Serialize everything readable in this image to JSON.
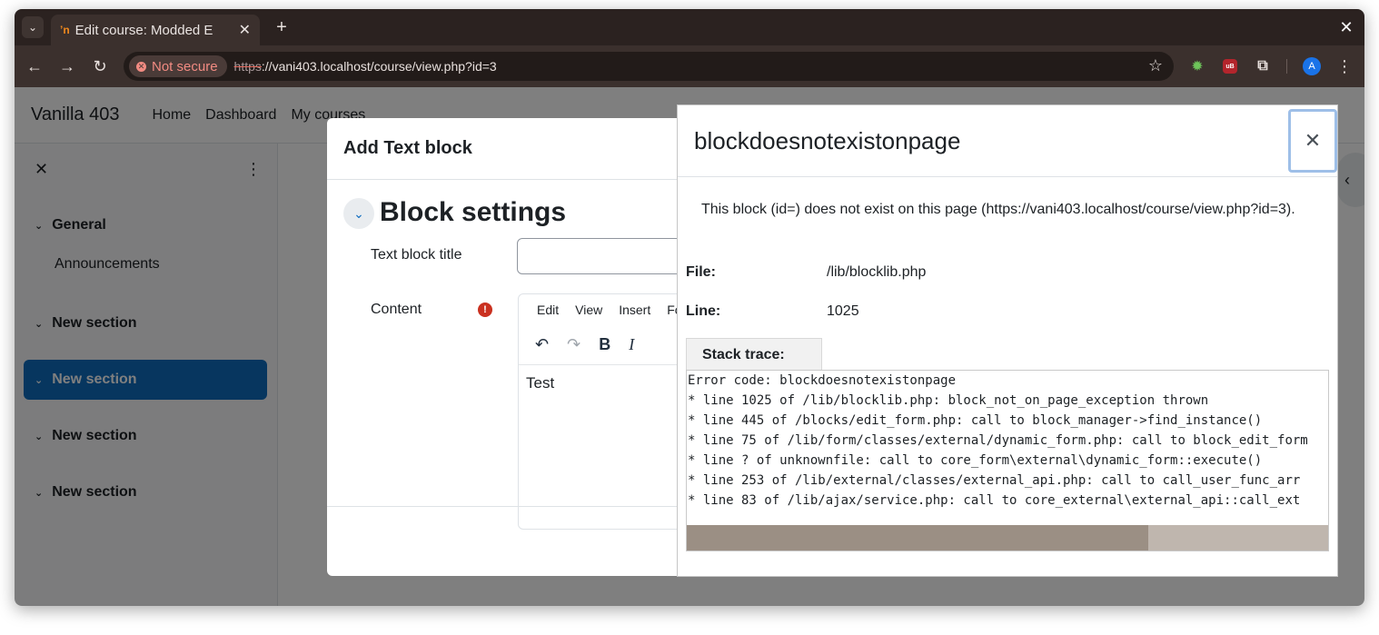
{
  "browser": {
    "tab_title": "Edit course: Modded E",
    "favicon": "ʼn",
    "security_label": "Not secure",
    "url_scheme": "https",
    "url_rest": "://vani403.localhost/course/view.php?id=3",
    "profile_initial": "A"
  },
  "navbar": {
    "site_name": "Vanilla 403",
    "links": [
      "Home",
      "Dashboard",
      "My courses"
    ]
  },
  "drawer": {
    "items": [
      {
        "label": "General"
      },
      {
        "label": "New section"
      },
      {
        "label": "New section"
      },
      {
        "label": "New section"
      },
      {
        "label": "New section"
      }
    ],
    "sub_item": "Announcements"
  },
  "add_block_modal": {
    "title": "Add Text block",
    "section_title": "Block settings",
    "title_label": "Text block title",
    "content_label": "Content",
    "editor_menu": [
      "Edit",
      "View",
      "Insert",
      "Fo"
    ],
    "editor_text": "Test"
  },
  "error_modal": {
    "title": "blockdoesnotexistonpage",
    "message": "This block (id=) does not exist on this page (https://vani403.localhost/course/view.php?id=3).",
    "file_label": "File:",
    "file_value": "/lib/blocklib.php",
    "line_label": "Line:",
    "line_value": "1025",
    "stack_label": "Stack trace:",
    "stack_trace": "Error code: blockdoesnotexistonpage\n* line 1025 of /lib/blocklib.php: block_not_on_page_exception thrown\n* line 445 of /blocks/edit_form.php: call to block_manager->find_instance()\n* line 75 of /lib/form/classes/external/dynamic_form.php: call to block_edit_form\n* line ? of unknownfile: call to core_form\\external\\dynamic_form::execute()\n* line 253 of /lib/external/classes/external_api.php: call to call_user_func_arr\n* line 83 of /lib/ajax/service.php: call to core_external\\external_api::call_ext",
    "scroll_position": 0.72
  },
  "colors": {
    "accent": "#0f6cbf",
    "required": "#ca3120",
    "browser_frame": "#3b302d"
  }
}
